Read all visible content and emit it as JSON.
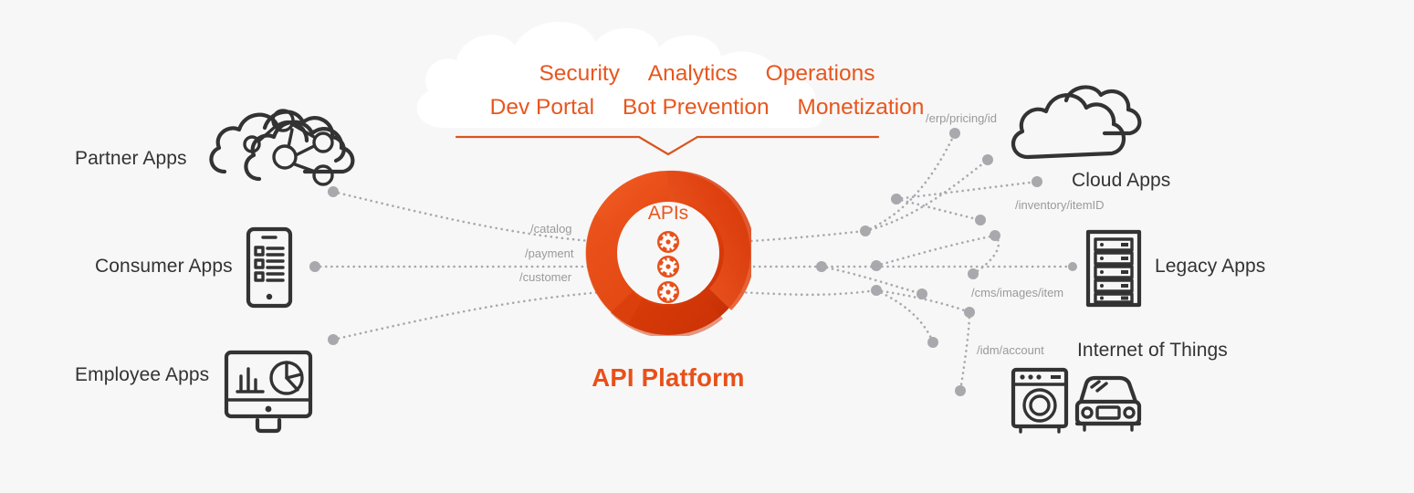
{
  "meta": {
    "background_color": "#f7f7f7",
    "accent_color": "#E8501A",
    "accent_light": "#E8561E",
    "line_color": "#a8a8ad",
    "icon_color": "#333333"
  },
  "cloud_callout": {
    "row1": [
      "Security",
      "Analytics",
      "Operations"
    ],
    "row2": [
      "Dev Portal",
      "Bot Prevention",
      "Monetization"
    ]
  },
  "center": {
    "ring_label": "APIs",
    "title": "API Platform",
    "gear_count": 3,
    "gear_icon": "gear-icon"
  },
  "left_groups": [
    {
      "label": "Partner Apps",
      "icon": "cloud-network-icon"
    },
    {
      "label": "Consumer Apps",
      "icon": "smartphone-icon"
    },
    {
      "label": "Employee Apps",
      "icon": "desktop-analytics-icon"
    }
  ],
  "right_groups": [
    {
      "label": "Cloud Apps",
      "icon": "clouds-icon"
    },
    {
      "label": "Legacy Apps",
      "icon": "server-rack-icon"
    },
    {
      "label": "Internet of Things",
      "icon": "washing-machine-icon, car-icon"
    }
  ],
  "left_api_paths": [
    "/catalog",
    "/payment",
    "/customer"
  ],
  "right_api_paths": [
    "/erp/pricing/id",
    "/inventory/itemID",
    "/cms/images/item",
    "/idm/account"
  ]
}
